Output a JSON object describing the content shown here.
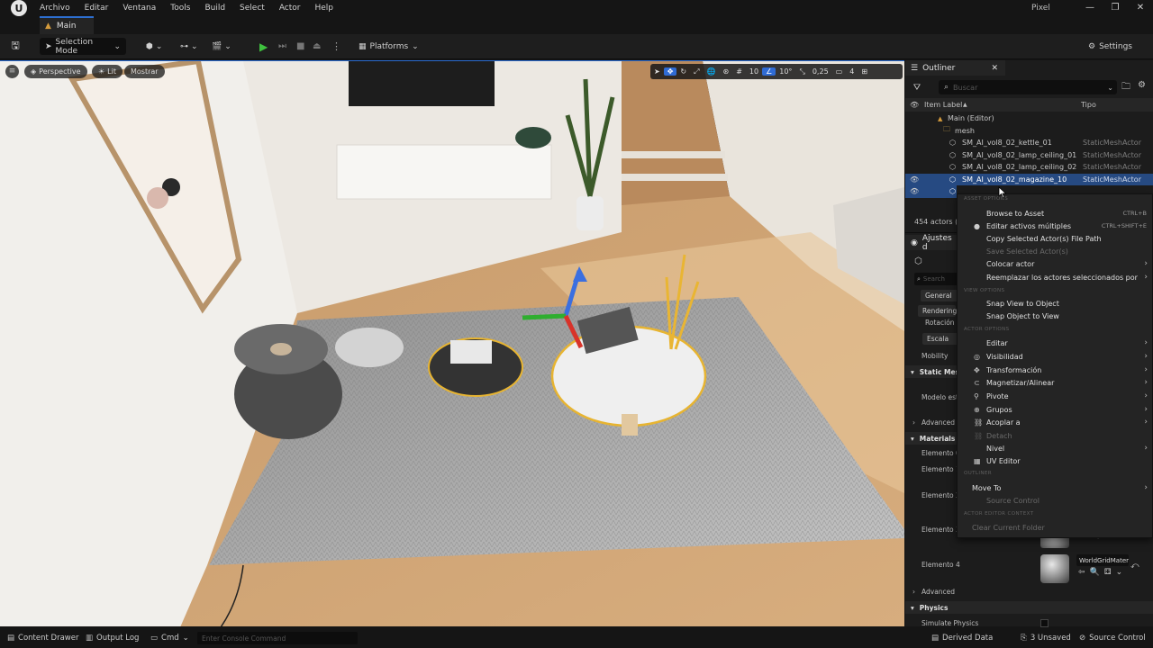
{
  "app": {
    "logo": "U",
    "title": "Pixel"
  },
  "menubar": {
    "items": [
      "Archivo",
      "Editar",
      "Ventana",
      "Tools",
      "Build",
      "Select",
      "Actor",
      "Help"
    ]
  },
  "window_controls": {
    "minimize": "—",
    "maximize": "❐",
    "close": "✕"
  },
  "tabs": {
    "main": "Main"
  },
  "toolbar": {
    "selection_mode": "Selection Mode",
    "platforms": "Platforms",
    "settings": "Settings"
  },
  "viewport": {
    "perspective": "Perspective",
    "lit": "Lit",
    "show": "Mostrar",
    "grid_snap": "10",
    "rotation_snap": "10°",
    "scale_snap": "0,25",
    "camera_speed": "4"
  },
  "outliner": {
    "tab": "Outliner",
    "search_placeholder": "Buscar",
    "col_label": "Item Label",
    "col_type": "Tipo",
    "rows": [
      {
        "label": "Main (Editor)",
        "type": ""
      },
      {
        "label": "mesh",
        "type": ""
      },
      {
        "label": "SM_AI_vol8_02_kettle_01",
        "type": "StaticMeshActor"
      },
      {
        "label": "SM_AI_vol8_02_lamp_ceiling_01",
        "type": "StaticMeshActor"
      },
      {
        "label": "SM_AI_vol8_02_lamp_ceiling_02",
        "type": "StaticMeshActor"
      },
      {
        "label": "SM_AI_vol8_02_magazine_10",
        "type": "StaticMeshActor"
      }
    ],
    "actor_count": "454 actors ("
  },
  "details": {
    "tab": "Ajustes d",
    "search": "Search",
    "general": "General",
    "rendering": "Rendering",
    "rotation": "Rotación",
    "scale": "Escala",
    "mobility": "Mobility",
    "static_mesh_section": "Static Mesl",
    "model_label": "Modelo est",
    "advanced_1": "Advanced",
    "materials_section": "Materials",
    "elements": [
      "Elemento 0",
      "Elemento 1",
      "Elemento 2",
      "Elemento 3",
      "Elemento 4"
    ],
    "material_name": "WorldGridMater",
    "advanced_2": "Advanced",
    "physics_section": "Physics",
    "simulate_physics": "Simulate Physics"
  },
  "context_menu": {
    "headings": {
      "asset": "ASSET OPTIONS",
      "view": "VIEW OPTIONS",
      "actor": "ACTOR OPTIONS",
      "outliner": "OUTLINER",
      "actor_editor": "ACTOR EDITOR CONTEXT"
    },
    "items": {
      "browse_to_asset": {
        "label": "Browse to Asset",
        "shortcut": "CTRL+B"
      },
      "edit_multiple": {
        "label": "Editar activos múltiples",
        "shortcut": "CTRL+SHIFT+E"
      },
      "copy_path": {
        "label": "Copy Selected Actor(s) File Path"
      },
      "save_selected": {
        "label": "Save Selected Actor(s)"
      },
      "place_actor": {
        "label": "Colocar actor"
      },
      "replace_actors": {
        "label": "Reemplazar los actores seleccionados por"
      },
      "snap_view": {
        "label": "Snap View to Object"
      },
      "snap_object": {
        "label": "Snap Object to View"
      },
      "edit": {
        "label": "Editar"
      },
      "visibility": {
        "label": "Visibilidad"
      },
      "transform": {
        "label": "Transformación"
      },
      "snap_align": {
        "label": "Magnetizar/Alinear"
      },
      "pivot": {
        "label": "Pivote"
      },
      "groups": {
        "label": "Grupos"
      },
      "attach_to": {
        "label": "Acoplar a"
      },
      "detach": {
        "label": "Detach"
      },
      "level": {
        "label": "Nivel"
      },
      "uv_editor": {
        "label": "UV Editor"
      },
      "move_to": {
        "label": "Move To"
      },
      "source_control": {
        "label": "Source Control"
      },
      "clear_folder": {
        "label": "Clear Current Folder"
      }
    }
  },
  "statusbar": {
    "content_drawer": "Content Drawer",
    "output_log": "Output Log",
    "cmd": "Cmd",
    "console_placeholder": "Enter Console Command",
    "derived_data": "Derived Data",
    "unsaved": "3 Unsaved",
    "source_control": "Source Control"
  },
  "colors": {
    "accent": "#2d6fd1",
    "selection": "#264a82",
    "play": "#3fc23f"
  }
}
